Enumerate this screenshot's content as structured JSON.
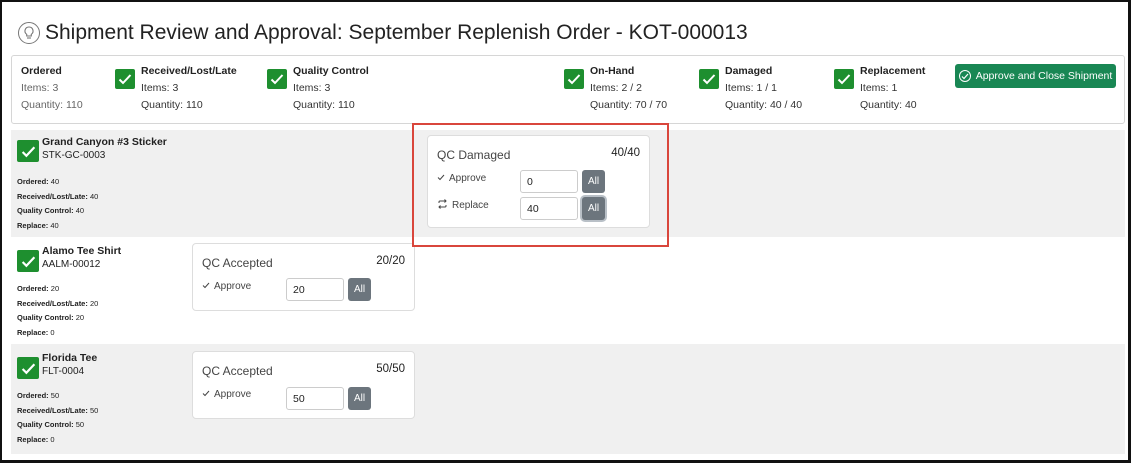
{
  "page": {
    "title": "Shipment Review and Approval: September Replenish Order - KOT-000013"
  },
  "summary": {
    "ordered": {
      "label": "Ordered",
      "items": "Items: 3",
      "quantity": "Quantity: 110"
    },
    "received": {
      "label": "Received/Lost/Late",
      "items": "Items: 3",
      "quantity": "Quantity: 110"
    },
    "quality_control": {
      "label": "Quality Control",
      "items": "Items: 3",
      "quantity": "Quantity: 110"
    },
    "on_hand": {
      "label": "On-Hand",
      "items": "Items: 2 / 2",
      "quantity": "Quantity: 70 / 70"
    },
    "damaged": {
      "label": "Damaged",
      "items": "Items: 1 / 1",
      "quantity": "Quantity: 40 / 40"
    },
    "replacement": {
      "label": "Replacement",
      "items": "Items: 1",
      "quantity": "Quantity: 40"
    },
    "approve_button": "Approve and Close Shipment"
  },
  "items": [
    {
      "name": "Grand Canyon #3 Sticker",
      "sku": "STK-GC-0003",
      "ordered": "40",
      "received": "40",
      "qc": "40",
      "replace": "40",
      "card": {
        "title": "QC Damaged",
        "count": "40/40",
        "approve_label": "Approve",
        "approve_value": "0",
        "replace_label": "Replace",
        "replace_value": "40",
        "all_label": "All"
      }
    },
    {
      "name": "Alamo Tee Shirt",
      "sku": "AALM-00012",
      "ordered": "20",
      "received": "20",
      "qc": "20",
      "replace": "0",
      "card": {
        "title": "QC Accepted",
        "count": "20/20",
        "approve_label": "Approve",
        "approve_value": "20",
        "all_label": "All"
      }
    },
    {
      "name": "Florida Tee",
      "sku": "FLT-0004",
      "ordered": "50",
      "received": "50",
      "qc": "50",
      "replace": "0",
      "card": {
        "title": "QC Accepted",
        "count": "50/50",
        "approve_label": "Approve",
        "approve_value": "50",
        "all_label": "All"
      }
    }
  ],
  "labels": {
    "ordered": "Ordered:",
    "received": "Received/Lost/Late:",
    "qc": "Quality Control:",
    "replace": "Replace:"
  },
  "colors": {
    "success": "#1e8f2f",
    "button": "#198754",
    "secondary": "#6c757d",
    "highlight": "#d9463c"
  }
}
